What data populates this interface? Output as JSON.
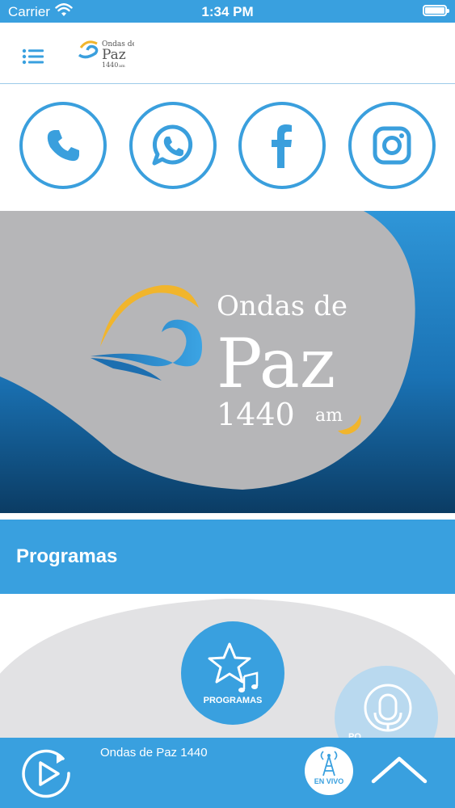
{
  "status_bar": {
    "carrier": "Carrier",
    "time": "1:34 PM"
  },
  "header": {
    "logo": {
      "line1": "Ondas de",
      "line2": "Paz",
      "line3": "1440",
      "suffix": "am"
    }
  },
  "social": [
    {
      "name": "phone-button",
      "icon": "phone-icon"
    },
    {
      "name": "whatsapp-button",
      "icon": "whatsapp-icon"
    },
    {
      "name": "facebook-button",
      "icon": "facebook-icon"
    },
    {
      "name": "instagram-button",
      "icon": "instagram-icon"
    }
  ],
  "banner": {
    "line1": "Ondas de",
    "line2": "Paz",
    "line3": "1440",
    "suffix": "am"
  },
  "section": {
    "title": "Programas"
  },
  "programs": {
    "primary_label": "PROGRAMAS",
    "secondary_label": "PO"
  },
  "player": {
    "title": "Ondas de Paz 1440",
    "live_label": "EN VIVO"
  },
  "colors": {
    "accent": "#39a0df",
    "banner_gray": "#b6b6b8",
    "banner_blue_dark": "#0b3c64",
    "sun": "#f1b52c"
  }
}
